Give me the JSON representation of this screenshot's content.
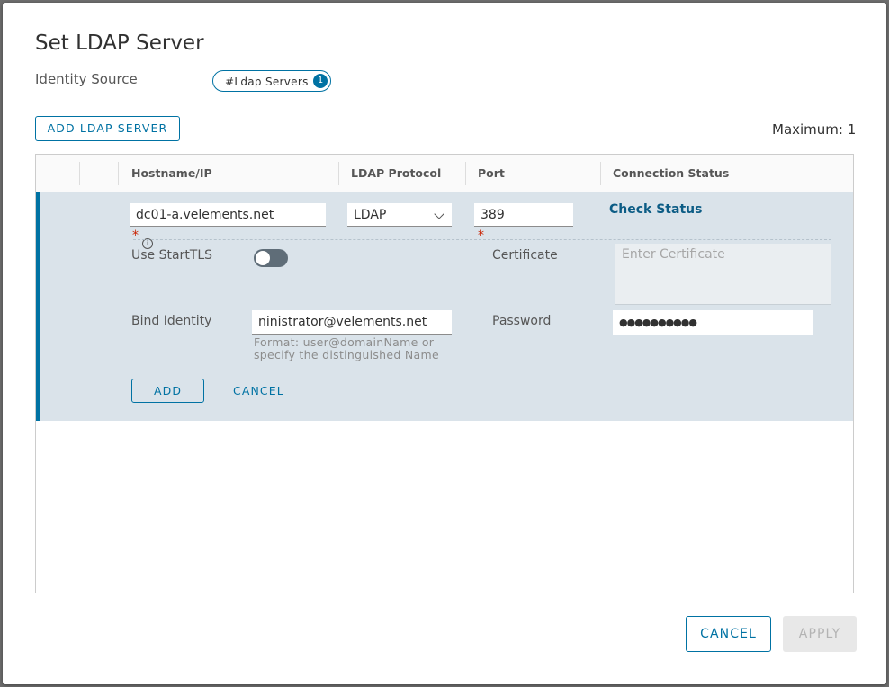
{
  "dialog": {
    "title": "Set LDAP Server",
    "identity_source_label": "Identity Source",
    "identity_source_tag": "#Ldap Servers",
    "identity_source_count": "1",
    "add_server_label": "ADD LDAP SERVER",
    "maximum_text": "Maximum: 1"
  },
  "grid": {
    "columns": [
      "Hostname/IP",
      "LDAP Protocol",
      "Port",
      "Connection Status"
    ],
    "row": {
      "hostname": "dc01-a.velements.net",
      "protocol": "LDAP",
      "port": "389",
      "check_status": "Check Status",
      "required_mark": "*",
      "use_starttls_label": "Use StartTLS",
      "starttls_enabled": false,
      "certificate_label": "Certificate",
      "certificate_placeholder": "Enter Certificate",
      "bind_identity_label": "Bind Identity",
      "bind_identity_value": "ninistrator@velements.net",
      "bind_identity_hint_1": "Format: user@domainName or",
      "bind_identity_hint_2": "specify the distinguished Name",
      "password_label": "Password",
      "password_value": "●●●●●●●●●●",
      "add_label": "ADD",
      "cancel_label": "CANCEL"
    }
  },
  "footer": {
    "cancel_label": "CANCEL",
    "apply_label": "APPLY"
  },
  "colors": {
    "accent": "#0072a3",
    "row_bg": "#dae3ea"
  }
}
